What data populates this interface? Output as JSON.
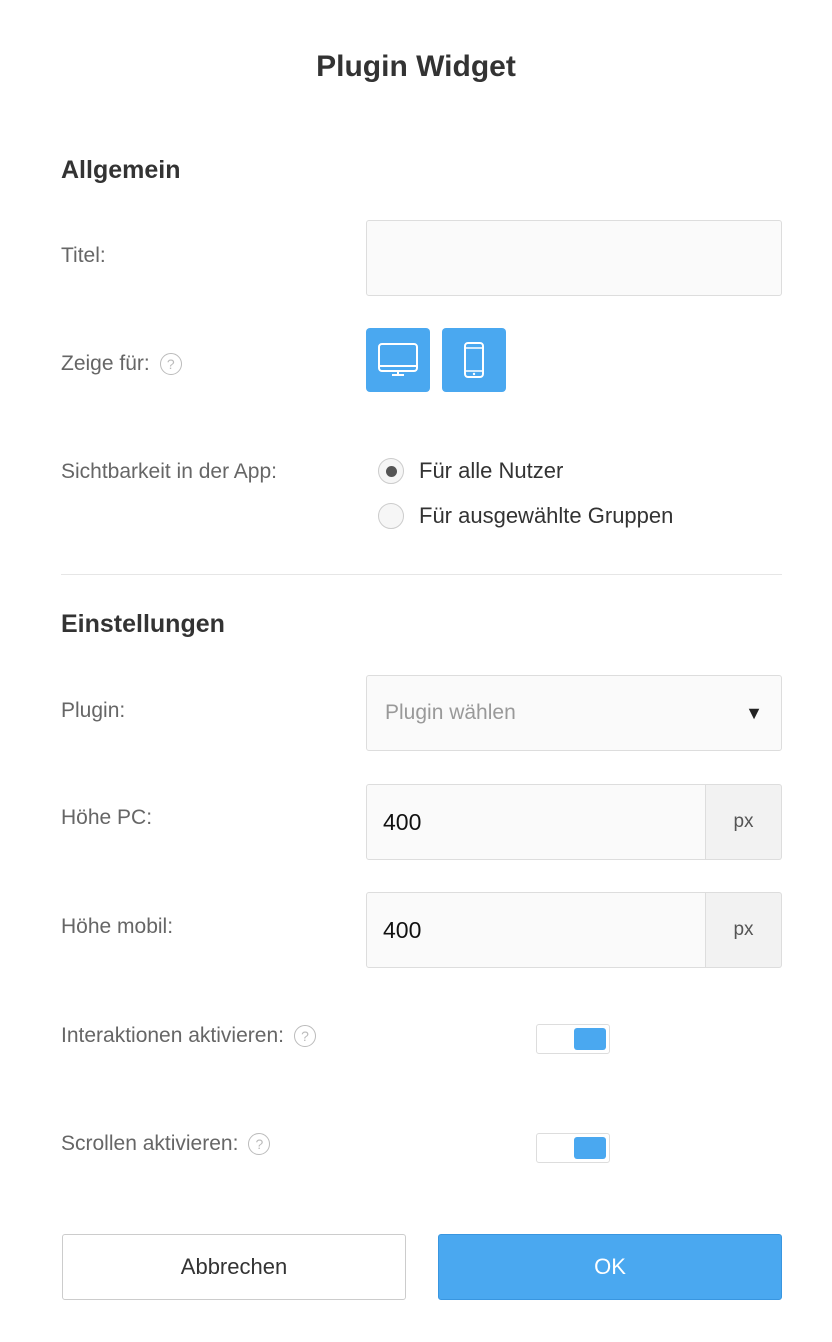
{
  "dialog": {
    "title": "Plugin Widget"
  },
  "general": {
    "heading": "Allgemein",
    "title_label": "Titel:",
    "title_value": "",
    "show_for_label": "Zeige für:",
    "devices": [
      {
        "name": "desktop",
        "icon": "monitor-icon",
        "active": true
      },
      {
        "name": "mobile",
        "icon": "smartphone-icon",
        "active": true
      }
    ],
    "visibility_label": "Sichtbarkeit in der App:",
    "visibility_options": [
      {
        "label": "Für alle Nutzer",
        "selected": true
      },
      {
        "label": "Für ausgewählte Gruppen",
        "selected": false
      }
    ]
  },
  "settings": {
    "heading": "Einstellungen",
    "plugin_label": "Plugin:",
    "plugin_placeholder": "Plugin wählen",
    "height_pc_label": "Höhe PC:",
    "height_pc_value": "400",
    "height_mobile_label": "Höhe mobil:",
    "height_mobile_value": "400",
    "unit": "px",
    "interactions_label": "Interaktionen aktivieren:",
    "interactions_enabled": true,
    "scroll_label": "Scrollen aktivieren:",
    "scroll_enabled": true
  },
  "actions": {
    "cancel_label": "Abbrechen",
    "ok_label": "OK"
  },
  "colors": {
    "accent": "#4aa8f0",
    "help_icon": "#bbbbbb"
  },
  "icons": {
    "help": "help-icon",
    "dropdown": "caret-down-icon"
  }
}
